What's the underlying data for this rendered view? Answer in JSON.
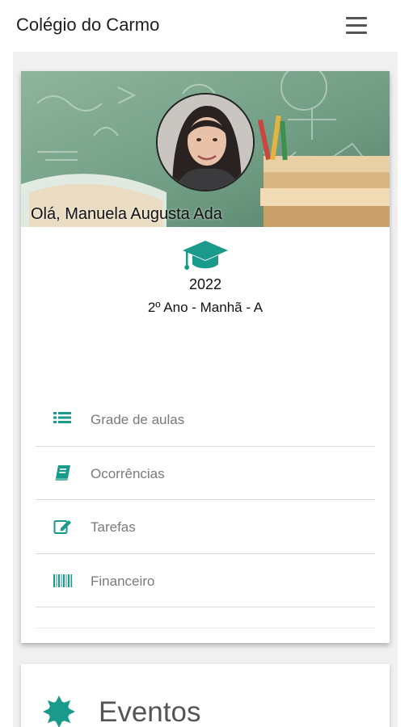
{
  "header": {
    "app_title": "Colégio do Carmo"
  },
  "profile": {
    "greeting": "Olá, Manuela Augusta Ada",
    "year": "2022",
    "class_info": "2º Ano - Manhã - A"
  },
  "menu": {
    "items": [
      {
        "label": "Grade de aulas",
        "icon": "list-icon"
      },
      {
        "label": "Ocorrências",
        "icon": "book-icon"
      },
      {
        "label": "Tarefas",
        "icon": "edit-icon"
      },
      {
        "label": "Financeiro",
        "icon": "barcode-icon"
      }
    ]
  },
  "events": {
    "title": "Eventos",
    "icon": "certificate-icon"
  },
  "colors": {
    "accent": "#1a9a8a",
    "text_muted": "#7a7a7a"
  }
}
